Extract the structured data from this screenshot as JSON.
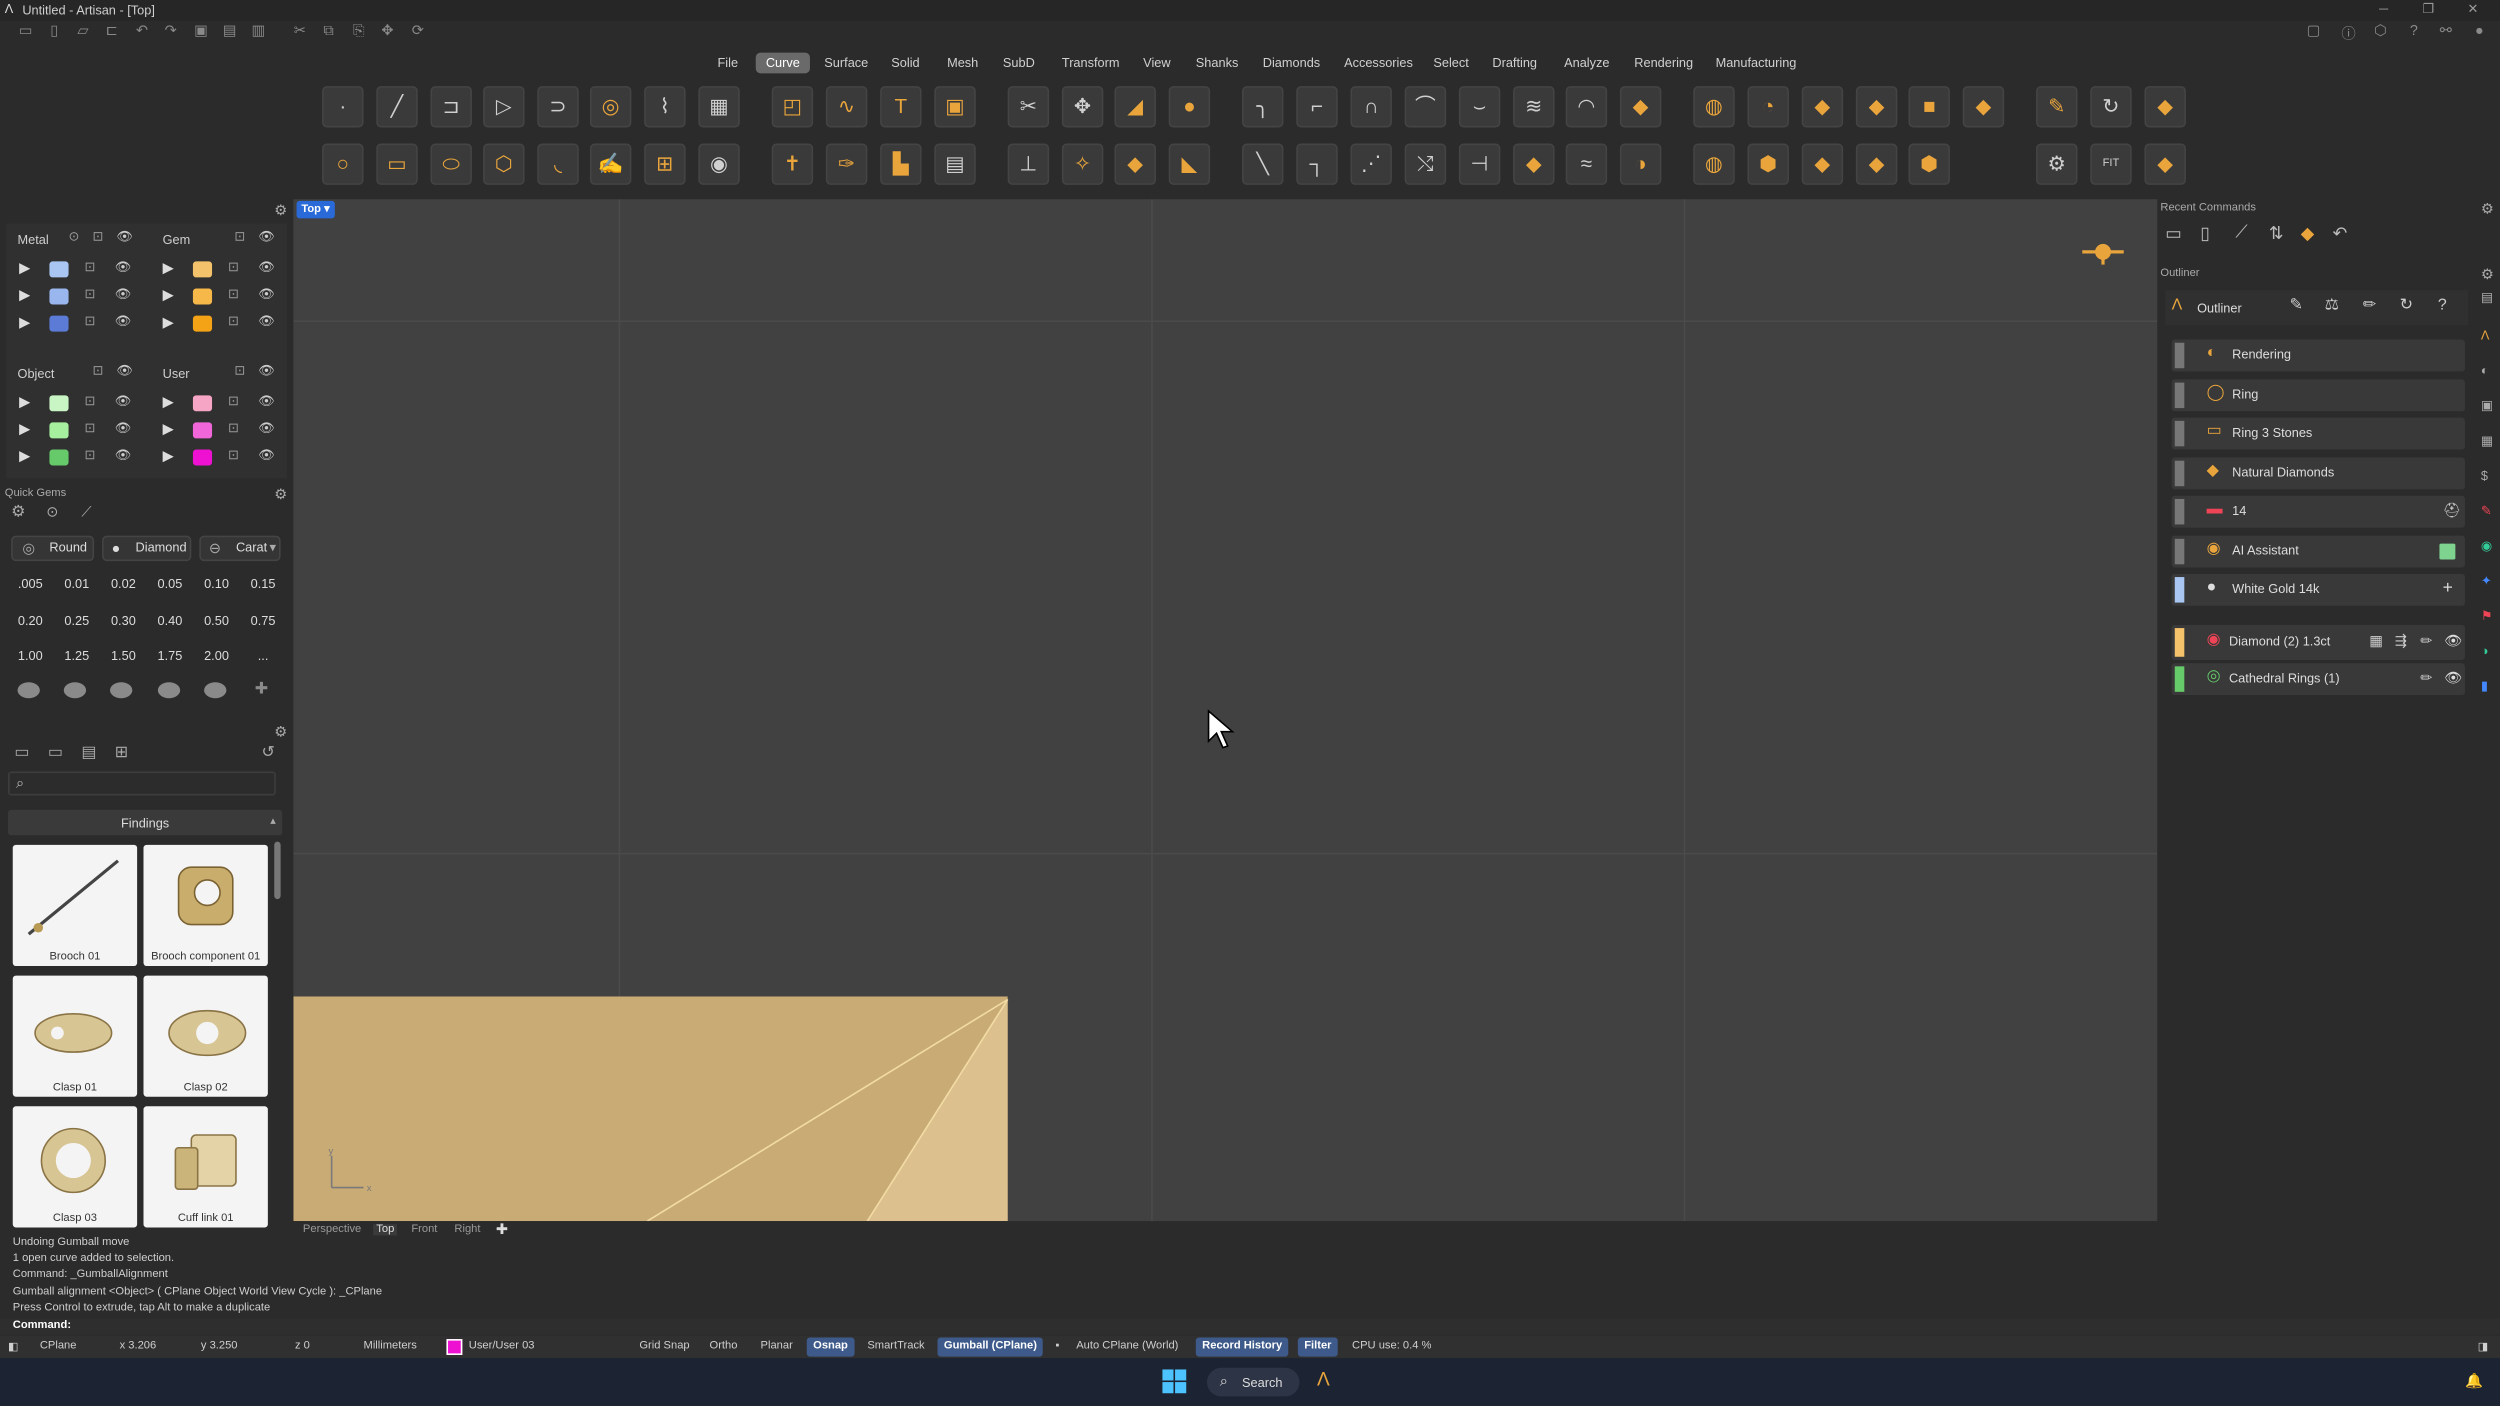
{
  "window": {
    "title": "Untitled - Artisan - [Top]"
  },
  "menus": [
    "File",
    "Curve",
    "Surface",
    "Solid",
    "Mesh",
    "SubD",
    "Transform",
    "View",
    "Shanks",
    "Diamonds",
    "Accessories",
    "Select",
    "Drafting",
    "Analyze",
    "Rendering",
    "Manufacturing"
  ],
  "active_menu": "Curve",
  "layers": {
    "metal": "Metal",
    "gem": "Gem",
    "object": "Object",
    "user": "User",
    "metal_colors": [
      "#a9c6f2",
      "#9ab6ee",
      "#5b7bd6"
    ],
    "gem_colors": [
      "#f4c26a",
      "#f6b849",
      "#f5a316"
    ],
    "object_colors": [
      "#c9f5c4",
      "#a5ef9e",
      "#66c96a"
    ],
    "user_colors": [
      "#f7a5c4",
      "#f166d9",
      "#ee11d2"
    ]
  },
  "quick_gems": {
    "title": "Quick Gems",
    "shape": "Round",
    "material": "Diamond",
    "unit": "Carat",
    "sizes": [
      ".005",
      "0.01",
      "0.02",
      "0.05",
      "0.10",
      "0.15",
      "0.20",
      "0.25",
      "0.30",
      "0.40",
      "0.50",
      "0.75",
      "1.00",
      "1.25",
      "1.50",
      "1.75",
      "2.00",
      "..."
    ]
  },
  "library": {
    "section": "Findings",
    "items": [
      "Brooch 01",
      "Brooch component 01",
      "Clasp 01",
      "Clasp 02",
      "Clasp 03",
      "Cuff link 01"
    ]
  },
  "viewport": {
    "label": "Top",
    "tabs": [
      "Perspective",
      "Top",
      "Front",
      "Right"
    ],
    "active_tab": "Top"
  },
  "right_panel": {
    "recent": "Recent Commands",
    "outliner_header": "Outliner",
    "outliner_title": "Outliner",
    "items": [
      {
        "label": "Rendering",
        "icon": "palette-icon"
      },
      {
        "label": "Ring",
        "icon": "ring-icon"
      },
      {
        "label": "Ring 3 Stones",
        "icon": "ring-stones-icon"
      },
      {
        "label": "Natural Diamonds",
        "icon": "diamond-icon"
      },
      {
        "label": "14",
        "icon": "flag-icon"
      },
      {
        "label": "AI Assistant",
        "icon": "assistant-icon"
      },
      {
        "label": "White Gold 14k",
        "icon": "material-icon"
      }
    ],
    "objects": [
      {
        "label": "Diamond (2) 1.3ct",
        "color": "#f4c26a"
      },
      {
        "label": "Cathedral Rings (1)",
        "color": "#66c96a"
      }
    ]
  },
  "command_history": [
    "Undoing Gumball move",
    "1 open curve added to selection.",
    "Command: _GumballAlignment",
    "Gumball alignment <Object> ( CPlane  Object  World  View  Cycle ): _CPlane",
    "Press Control to extrude, tap Alt to make a duplicate"
  ],
  "command_prompt": "Command:",
  "status": {
    "cplane": "CPlane",
    "x": "x 3.206",
    "y": "y 3.250",
    "z": "z 0",
    "units": "Millimeters",
    "layer": "User/User 03",
    "grid_snap": "Grid Snap",
    "ortho": "Ortho",
    "planar": "Planar",
    "osnap": "Osnap",
    "smarttrack": "SmartTrack",
    "gumball": "Gumball (CPlane)",
    "auto_cplane": "Auto CPlane (World)",
    "record_history": "Record History",
    "filter": "Filter",
    "cpu": "CPU use: 0.4 %"
  },
  "taskbar": {
    "search": "Search"
  }
}
